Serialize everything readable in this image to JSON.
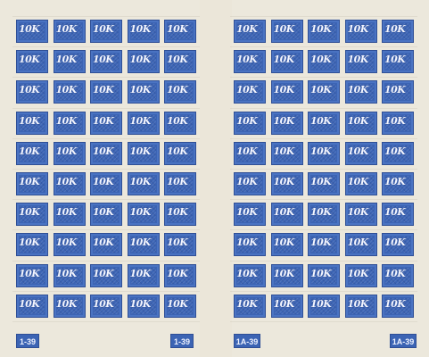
{
  "stamp_sheet": {
    "denomination": "10K",
    "ink_color": "#3c64b4",
    "paper_color": "#ece8dc",
    "panes": [
      {
        "name": "left",
        "columns": 5,
        "rows": 10
      },
      {
        "name": "right",
        "columns": 5,
        "rows": 10
      }
    ],
    "control_marks": [
      "1-39",
      "1-39",
      "1A-39",
      "1A-39"
    ]
  }
}
